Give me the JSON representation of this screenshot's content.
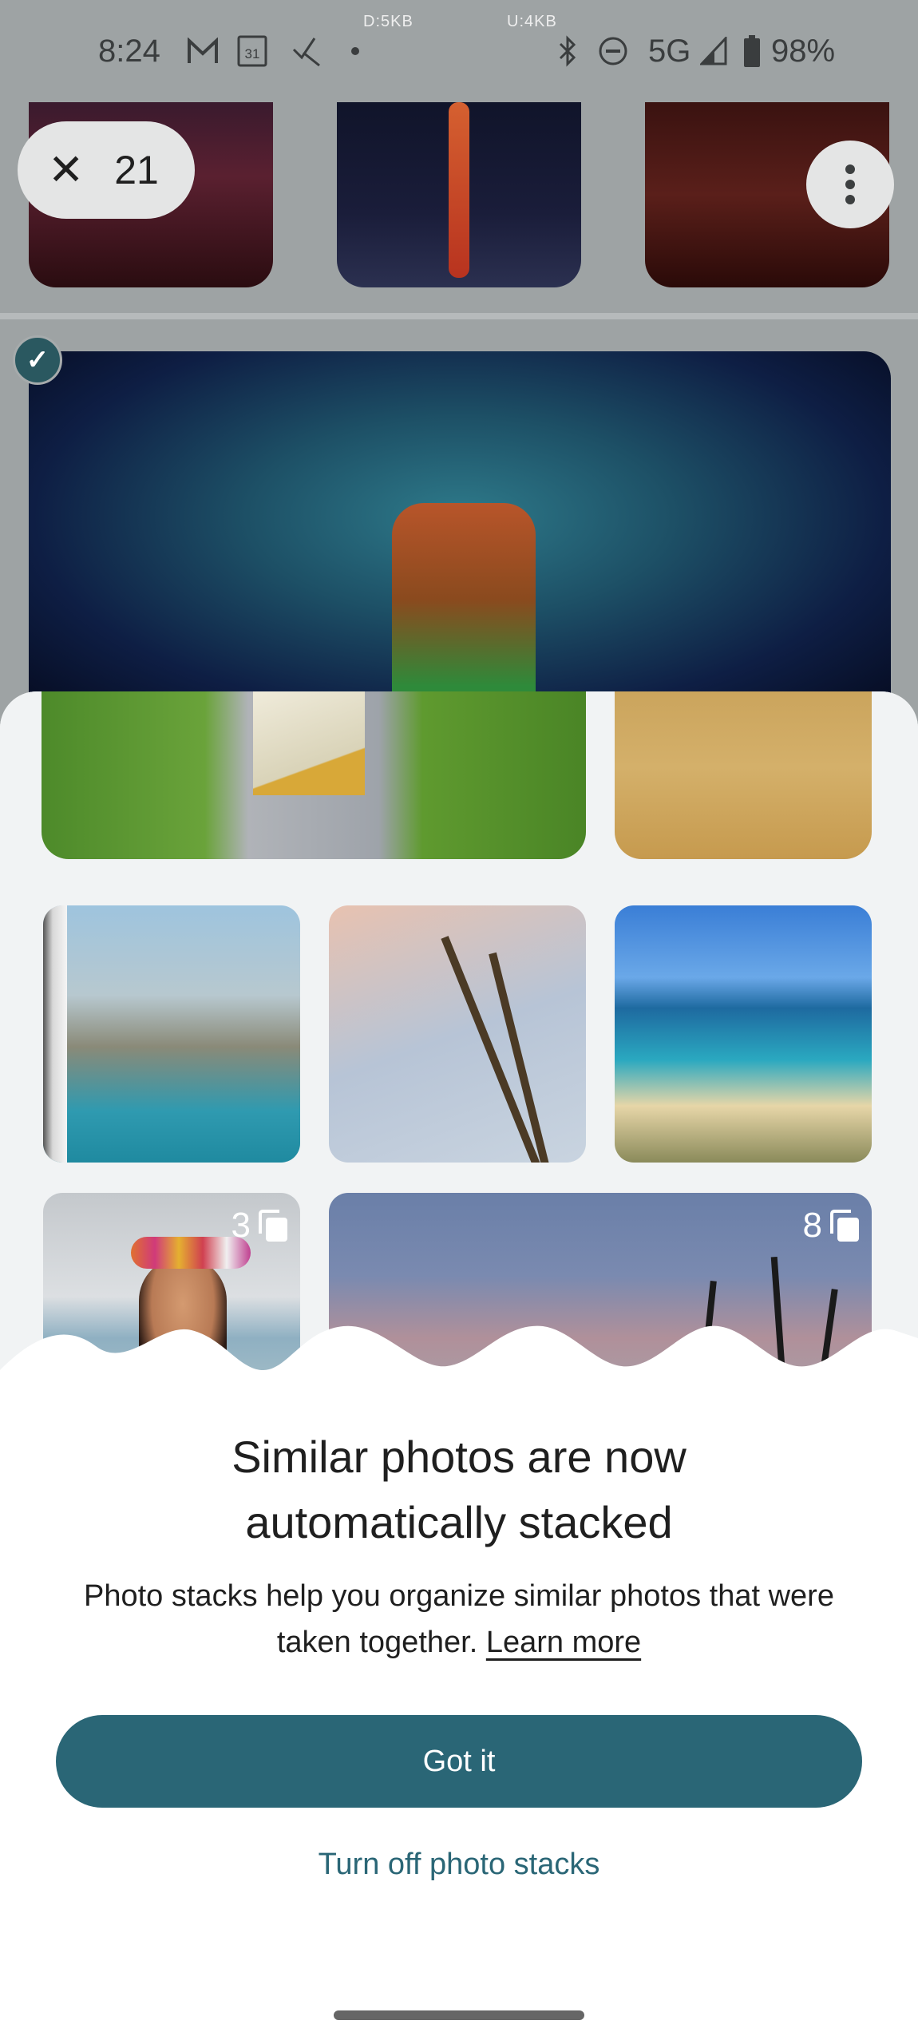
{
  "status_bar": {
    "time": "8:24",
    "download_rate": "D:5KB",
    "upload_rate": "U:4KB",
    "network": "5G",
    "battery": "98%",
    "left_icons": [
      "gmail-icon",
      "calendar-icon",
      "app-bird-icon",
      "notification-dot-icon"
    ],
    "calendar_day": "31",
    "right_icons": [
      "bluetooth-icon",
      "do-not-disturb-icon",
      "signal-icon",
      "battery-icon"
    ]
  },
  "selection_bar": {
    "close_label": "✕",
    "selected_count": "21",
    "more_options_icon": "more-vert-icon"
  },
  "dialog": {
    "title_line1": "Similar photos are now",
    "title_line2": "automatically stacked",
    "body_text": "Photo stacks help you organize similar photos that were taken together.",
    "learn_more": "Learn more",
    "primary_button": "Got it",
    "secondary_button": "Turn off photo stacks",
    "illustration": {
      "stacks": [
        {
          "count": "3"
        },
        {
          "count": "8"
        }
      ]
    }
  },
  "colors": {
    "accent": "#2a6676",
    "selection_check": "#2a5860",
    "scrim": "#9ea3a4"
  }
}
